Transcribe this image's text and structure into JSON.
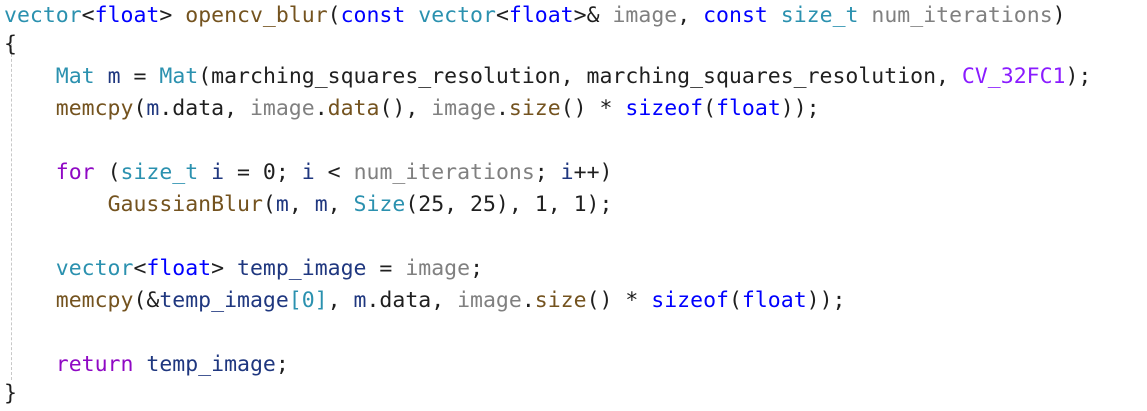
{
  "editor": {
    "language": "cpp",
    "lines": [
      [
        {
          "t": "vector",
          "c": "type"
        },
        {
          "t": "<",
          "c": "punc"
        },
        {
          "t": "float",
          "c": "kw"
        },
        {
          "t": "> ",
          "c": "punc"
        },
        {
          "t": "opencv_blur",
          "c": "fn"
        },
        {
          "t": "(",
          "c": "punc"
        },
        {
          "t": "const",
          "c": "kw"
        },
        {
          "t": " ",
          "c": "punc"
        },
        {
          "t": "vector",
          "c": "type"
        },
        {
          "t": "<",
          "c": "punc"
        },
        {
          "t": "float",
          "c": "kw"
        },
        {
          "t": ">& ",
          "c": "punc"
        },
        {
          "t": "image",
          "c": "param"
        },
        {
          "t": ", ",
          "c": "punc"
        },
        {
          "t": "const",
          "c": "kw"
        },
        {
          "t": " ",
          "c": "punc"
        },
        {
          "t": "size_t",
          "c": "type"
        },
        {
          "t": " ",
          "c": "punc"
        },
        {
          "t": "num_iterations",
          "c": "param"
        },
        {
          "t": ")",
          "c": "punc"
        }
      ],
      [
        {
          "t": "{",
          "c": "punc"
        }
      ],
      [
        {
          "t": "    ",
          "c": "punc"
        },
        {
          "t": "Mat",
          "c": "type"
        },
        {
          "t": " ",
          "c": "punc"
        },
        {
          "t": "m",
          "c": "var"
        },
        {
          "t": " = ",
          "c": "punc"
        },
        {
          "t": "Mat",
          "c": "type"
        },
        {
          "t": "(marching_squares_resolution, marching_squares_resolution, ",
          "c": "punc"
        },
        {
          "t": "CV_32FC1",
          "c": "macro"
        },
        {
          "t": ");",
          "c": "punc"
        }
      ],
      [
        {
          "t": "    ",
          "c": "punc"
        },
        {
          "t": "memcpy",
          "c": "fn"
        },
        {
          "t": "(",
          "c": "punc"
        },
        {
          "t": "m",
          "c": "var"
        },
        {
          "t": ".data, ",
          "c": "punc"
        },
        {
          "t": "image",
          "c": "param"
        },
        {
          "t": ".",
          "c": "punc"
        },
        {
          "t": "data",
          "c": "fn"
        },
        {
          "t": "(), ",
          "c": "punc"
        },
        {
          "t": "image",
          "c": "param"
        },
        {
          "t": ".",
          "c": "punc"
        },
        {
          "t": "size",
          "c": "fn"
        },
        {
          "t": "() * ",
          "c": "punc"
        },
        {
          "t": "sizeof",
          "c": "kw"
        },
        {
          "t": "(",
          "c": "punc"
        },
        {
          "t": "float",
          "c": "kw"
        },
        {
          "t": "));",
          "c": "punc"
        }
      ],
      [],
      [
        {
          "t": "    ",
          "c": "punc"
        },
        {
          "t": "for",
          "c": "ctrl"
        },
        {
          "t": " (",
          "c": "punc"
        },
        {
          "t": "size_t",
          "c": "type"
        },
        {
          "t": " ",
          "c": "punc"
        },
        {
          "t": "i",
          "c": "var"
        },
        {
          "t": " = 0; ",
          "c": "punc"
        },
        {
          "t": "i",
          "c": "var"
        },
        {
          "t": " < ",
          "c": "punc"
        },
        {
          "t": "num_iterations",
          "c": "param"
        },
        {
          "t": "; ",
          "c": "punc"
        },
        {
          "t": "i",
          "c": "var"
        },
        {
          "t": "++)",
          "c": "punc"
        }
      ],
      [
        {
          "t": "        ",
          "c": "punc"
        },
        {
          "t": "GaussianBlur",
          "c": "fn"
        },
        {
          "t": "(",
          "c": "punc"
        },
        {
          "t": "m",
          "c": "var"
        },
        {
          "t": ", ",
          "c": "punc"
        },
        {
          "t": "m",
          "c": "var"
        },
        {
          "t": ", ",
          "c": "punc"
        },
        {
          "t": "Size",
          "c": "type"
        },
        {
          "t": "(25, 25), 1, 1);",
          "c": "punc"
        }
      ],
      [],
      [
        {
          "t": "    ",
          "c": "punc"
        },
        {
          "t": "vector",
          "c": "type"
        },
        {
          "t": "<",
          "c": "punc"
        },
        {
          "t": "float",
          "c": "kw"
        },
        {
          "t": "> ",
          "c": "punc"
        },
        {
          "t": "temp_image",
          "c": "var"
        },
        {
          "t": " = ",
          "c": "punc"
        },
        {
          "t": "image",
          "c": "param"
        },
        {
          "t": ";",
          "c": "punc"
        }
      ],
      [
        {
          "t": "    ",
          "c": "punc"
        },
        {
          "t": "memcpy",
          "c": "fn"
        },
        {
          "t": "(&",
          "c": "punc"
        },
        {
          "t": "temp_image",
          "c": "var"
        },
        {
          "t": "[0]",
          "c": "type"
        },
        {
          "t": ", ",
          "c": "punc"
        },
        {
          "t": "m",
          "c": "var"
        },
        {
          "t": ".data, ",
          "c": "punc"
        },
        {
          "t": "image",
          "c": "param"
        },
        {
          "t": ".",
          "c": "punc"
        },
        {
          "t": "size",
          "c": "fn"
        },
        {
          "t": "() * ",
          "c": "punc"
        },
        {
          "t": "sizeof",
          "c": "kw"
        },
        {
          "t": "(",
          "c": "punc"
        },
        {
          "t": "float",
          "c": "kw"
        },
        {
          "t": "));",
          "c": "punc"
        }
      ],
      [],
      [
        {
          "t": "    ",
          "c": "punc"
        },
        {
          "t": "return",
          "c": "ctrl"
        },
        {
          "t": " ",
          "c": "punc"
        },
        {
          "t": "temp_image",
          "c": "var"
        },
        {
          "t": ";",
          "c": "punc"
        }
      ],
      [
        {
          "t": "}",
          "c": "punc"
        }
      ]
    ]
  },
  "colors": {
    "background": "#ffffff",
    "keyword": "#0000ff",
    "type": "#2b91af",
    "function": "#74531f",
    "parameter": "#808080",
    "local_variable": "#1f377f",
    "macro": "#8a1bff",
    "control_keyword": "#8f08c4",
    "plain_text": "#1f1f1f"
  }
}
